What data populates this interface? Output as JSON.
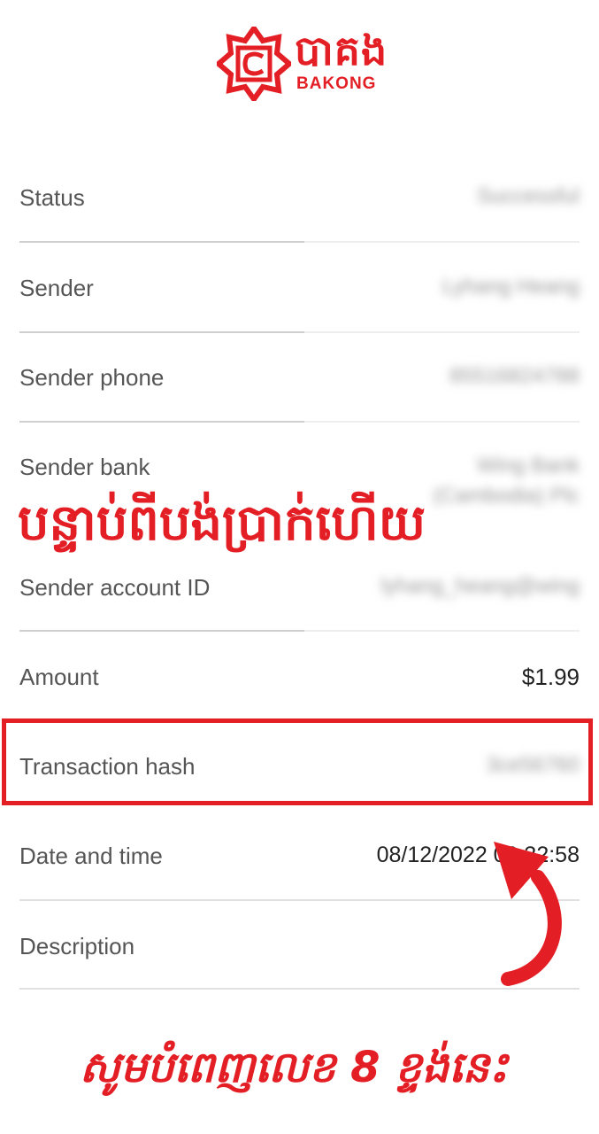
{
  "logo": {
    "khmer": "បាគង",
    "english": "BAKONG"
  },
  "rows": [
    {
      "label": "Status",
      "value": "Successful"
    },
    {
      "label": "Sender",
      "value": "Lyhang Heang"
    },
    {
      "label": "Sender phone",
      "value": "85516824788"
    },
    {
      "label": "Sender bank",
      "value": "Wing Bank",
      "value2": "(Cambodia) Plc"
    },
    {
      "label": "Sender account ID",
      "value": "lyhang_heang@wing"
    },
    {
      "label": "Amount",
      "value": "$1.99"
    },
    {
      "label": "Transaction hash",
      "value": "3ce56760"
    },
    {
      "label": "Date and time",
      "value": "08/12/2022 09:32:58"
    },
    {
      "label": "Description",
      "value": ""
    }
  ],
  "overlay": {
    "top_text": "បន្ទាប់ពីបង់ប្រាក់ហើយ",
    "bottom_text": "សូមបំពេញលេខ 8 ខ្ទង់នេះ"
  },
  "colors": {
    "accent": "#e31e24",
    "divider": "#d9d9d9",
    "label": "#555555"
  },
  "icons": [
    "bakong-logo-icon",
    "curved-arrow-icon"
  ]
}
